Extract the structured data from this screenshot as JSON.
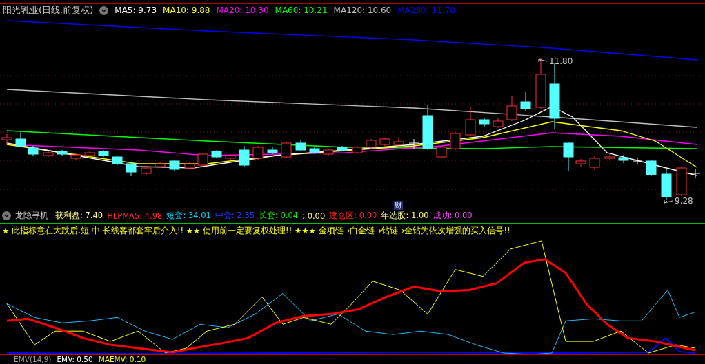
{
  "title": {
    "name": "阳光乳业(日线,前复权)"
  },
  "ma_legend": [
    {
      "label": "MA5: 9.73",
      "color": "#ffffff"
    },
    {
      "label": "MA10: 9.88",
      "color": "#ffff00"
    },
    {
      "label": "MA20: 10.30",
      "color": "#ff00ff"
    },
    {
      "label": "MA60: 10.21",
      "color": "#00ff00"
    },
    {
      "label": "MA120: 10.60",
      "color": "#c0c0c0"
    },
    {
      "label": "MA250: 11.78",
      "color": "#0000ff"
    }
  ],
  "price_chart": {
    "high_label": "11.80",
    "low_label": "9.28",
    "marker": "财"
  },
  "indicator": {
    "name": "龙隐寻机",
    "values": [
      {
        "label": "获利盘: 7.40",
        "color": "#ffff80"
      },
      {
        "label": "HLPMA5: 4.98",
        "color": "#ff2020"
      },
      {
        "label": "短套: 34.01",
        "color": "#00d8ff"
      },
      {
        "label": "中套: 2.35",
        "color": "#2040ff"
      },
      {
        "label": "长套: 0.04",
        "color": "#00ff00"
      },
      {
        "label": ": 0.00",
        "color": "#ffff80"
      },
      {
        "label": "建仓区: 0.00",
        "color": "#ff2020"
      },
      {
        "label": "年选股: 1.00",
        "color": "#ffff80"
      },
      {
        "label": "成功: 0.00",
        "color": "#ff40ff"
      }
    ],
    "notice": "★ 此指标意在大跌后,短-中-长线客都套牢后介入!! ★★ 使用前一定要复权处理!! ★★★ 金项链→白金链→钻链→金钻为依次增强的买入信号!!"
  },
  "bottom_legend": [
    {
      "label": "EMV(14,9)",
      "color": "#a0a0a0"
    },
    {
      "label": "EMV: 0.50",
      "color": "#ffffff"
    },
    {
      "label": "MAEMV: 0.10",
      "color": "#ffff00"
    }
  ]
}
